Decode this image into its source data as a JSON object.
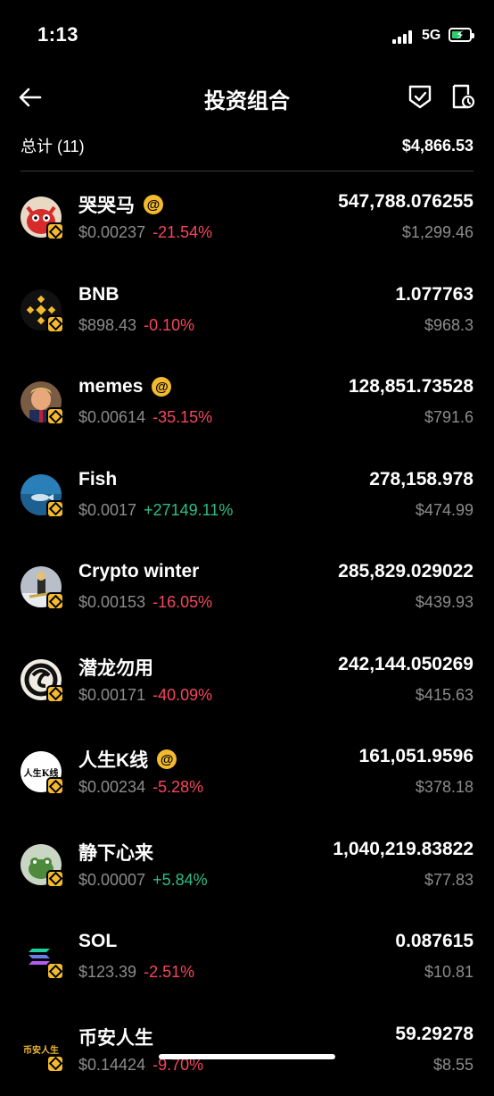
{
  "status_bar": {
    "time": "1:13",
    "network": "5G"
  },
  "header": {
    "title": "投资组合"
  },
  "summary": {
    "label": "总计 (11)",
    "total": "$4,866.53"
  },
  "assets": [
    {
      "name": "哭哭马",
      "at": "@",
      "price": "$0.00237",
      "change": "-21.54%",
      "direction": "negative",
      "amount": "547,788.076255",
      "value": "$1,299.46",
      "icon": "red-horse-avatar"
    },
    {
      "name": "BNB",
      "price": "$898.43",
      "change": "-0.10%",
      "direction": "negative",
      "amount": "1.077763",
      "value": "$968.3",
      "icon": "bnb-logo"
    },
    {
      "name": "memes",
      "at": "@",
      "price": "$0.00614",
      "change": "-35.15%",
      "direction": "negative",
      "amount": "128,851.73528",
      "value": "$791.6",
      "icon": "person-avatar"
    },
    {
      "name": "Fish",
      "price": "$0.0017",
      "change": "+27149.11%",
      "direction": "positive",
      "amount": "278,158.978",
      "value": "$474.99",
      "icon": "fish-avatar"
    },
    {
      "name": "Crypto winter",
      "price": "$0.00153",
      "change": "-16.05%",
      "direction": "negative",
      "amount": "285,829.029022",
      "value": "$439.93",
      "icon": "snow-avatar"
    },
    {
      "name": "潜龙勿用",
      "price": "$0.00171",
      "change": "-40.09%",
      "direction": "negative",
      "amount": "242,144.050269",
      "value": "$415.63",
      "icon": "dragon-avatar"
    },
    {
      "name": "人生K线",
      "at": "@",
      "price": "$0.00234",
      "change": "-5.28%",
      "direction": "negative",
      "amount": "161,051.9596",
      "value": "$378.18",
      "icon": "kline-avatar",
      "icon_text": "人生K线"
    },
    {
      "name": "静下心来",
      "price": "$0.00007",
      "change": "+5.84%",
      "direction": "positive",
      "amount": "1,040,219.83822",
      "value": "$77.83",
      "icon": "frog-avatar"
    },
    {
      "name": "SOL",
      "price": "$123.39",
      "change": "-2.51%",
      "direction": "negative",
      "amount": "0.087615",
      "value": "$10.81",
      "icon": "sol-logo"
    },
    {
      "name": "币安人生",
      "price": "$0.14424",
      "change": "-9.70%",
      "direction": "negative",
      "amount": "59.29278",
      "value": "$8.55",
      "icon": "binance-life-avatar",
      "icon_text": "币安人生"
    }
  ],
  "colors": {
    "negative": "#f6465d",
    "positive": "#2ebd85",
    "accent": "#f3ba2f",
    "muted": "#8c8c8c",
    "background": "#000000"
  }
}
